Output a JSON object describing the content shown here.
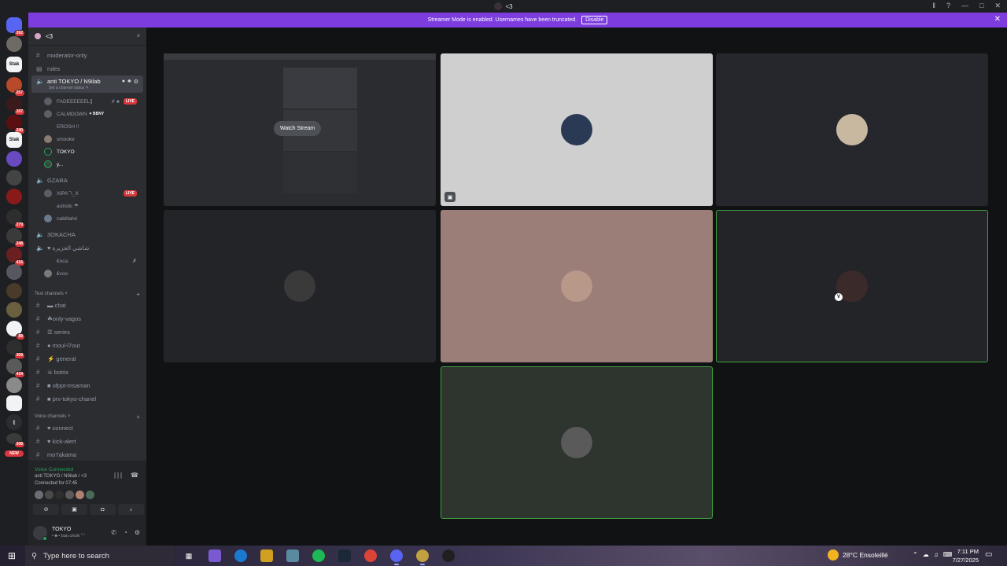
{
  "window": {
    "title": "<3",
    "controls": [
      "‖",
      "?",
      "—",
      "□",
      "✕"
    ]
  },
  "banner": {
    "text": "Streamer Mode is enabled. Usernames have been truncated.",
    "button": "Disable",
    "close": "✕"
  },
  "rail": {
    "badges": [
      "392",
      "257",
      "107",
      "240",
      "279",
      "248",
      "416",
      "89",
      "309",
      "434",
      "308"
    ],
    "new_label": "NEW",
    "letter_server": "t",
    "text_server": "Stak"
  },
  "guild": {
    "name": "<3",
    "chevron": "˅"
  },
  "channels": {
    "top": [
      {
        "name": "moderator-only"
      },
      {
        "name": "rules"
      }
    ],
    "active_voice": {
      "name": "anti TOKYO / N9ilab",
      "status": "Set a channel status ✎",
      "icons": [
        "●",
        "♣",
        "⚙"
      ]
    },
    "voice_users_1": [
      {
        "name": "FADEEEEEEL∥",
        "live": "LIVE",
        "extra": "✗ ♣"
      },
      {
        "name": "CALMDOWN",
        "tag": "♥ BBNY"
      },
      {
        "name": "EROSH !!"
      },
      {
        "name": "smooke"
      },
      {
        "name": "TOKYO"
      },
      {
        "name": "y..."
      }
    ],
    "gzara": {
      "name": "GZARA"
    },
    "voice_users_2": [
      {
        "name": "XIPA ˜\\_X",
        "live": "LIVE"
      },
      {
        "name": "autistic ☂"
      },
      {
        "name": "nabiltahri"
      }
    ],
    "zokacha": {
      "name": "3OKACHA"
    },
    "jazira": {
      "name": "♥ شاشي الجزيرة"
    },
    "voice_users_3": [
      {
        "name": "€oca",
        "mute": "✗"
      },
      {
        "name": "€voo"
      }
    ],
    "text_category": {
      "label": "Text channels ˅",
      "plus": "+"
    },
    "text_channels": [
      {
        "name": "▬ chat"
      },
      {
        "name": "☘only-vagos"
      },
      {
        "name": "☰ series"
      },
      {
        "name": "● moul-l7out"
      },
      {
        "name": "⚡ general"
      },
      {
        "name": "☠ botrix"
      },
      {
        "name": "■ ofppt-msaman"
      },
      {
        "name": "■ prv-tokyo-chanel"
      }
    ],
    "voice_category": {
      "label": "Voice channels ˅",
      "plus": "+"
    },
    "voice_channels": [
      {
        "name": "♥ connect"
      },
      {
        "name": "♥ kick-alert"
      },
      {
        "name": "mo7akama"
      }
    ]
  },
  "voice_panel": {
    "status": "Voice Connected",
    "channel": "anti TOKYO / N9ilab / <3",
    "time": "Connected for 07:45",
    "icons": [
      "∣∣∣",
      "☎"
    ],
    "buttons": [
      "⊘",
      "▣",
      "◘",
      "♪"
    ]
  },
  "user": {
    "name": "TOKYO",
    "sub": "• ■ • ban.chulk ˚‧˚",
    "controls": [
      "✆",
      "◔",
      "⚙"
    ]
  },
  "stage": {
    "watch_label": "Watch Stream",
    "share_icon": "▣",
    "v_badge": "V"
  },
  "taskbar": {
    "start": "⊞",
    "search_placeholder": "Type here to search",
    "weather": "28°C  Ensoleillé",
    "time": "7:11 PM",
    "date": "7/27/2025",
    "tray": [
      "⌃",
      "☁",
      "♫",
      "⌨"
    ],
    "notif": "▭"
  },
  "colors": {
    "accent": "#7d3cde",
    "live": "#da373c",
    "connected": "#23a55a",
    "speaking": "#3fa33f"
  }
}
